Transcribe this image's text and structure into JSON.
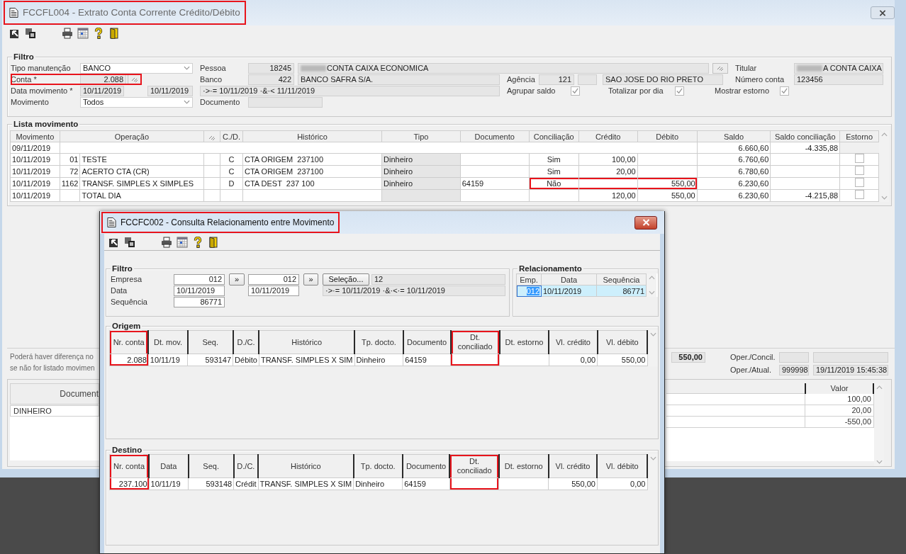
{
  "main_window": {
    "title": "FCCFL004 - Extrato Conta Corrente Crédito/Débito",
    "title_highlighted": true
  },
  "filtro": {
    "legend": "Filtro",
    "tipo_manutencao": {
      "label": "Tipo manutenção",
      "value": "BANCO"
    },
    "pessoa": {
      "label": "Pessoa",
      "code": "18245",
      "name": "CONTA CAIXA ECONOMICA",
      "redacted": true
    },
    "titular": {
      "label": "Titular",
      "value": "A CONTA CAIXA",
      "redacted": true
    },
    "conta": {
      "label": "Conta *",
      "value": "2.088",
      "highlighted": true
    },
    "banco": {
      "label": "Banco",
      "code": "422",
      "name": "BANCO SAFRA S/A."
    },
    "agencia": {
      "label": "Agência",
      "code": "121",
      "name": "SAO JOSE DO RIO PRETO"
    },
    "numero_conta": {
      "label": "Número conta",
      "value": "123456"
    },
    "data_movimento": {
      "label": "Data movimento *",
      "from": "10/11/2019",
      "to": "10/11/2019"
    },
    "period": "·>·= 10/11/2019 ·&·< 11/11/2019",
    "options": [
      {
        "label": "Agrupar saldo",
        "checked": true
      },
      {
        "label": "Totalizar por dia",
        "checked": true
      },
      {
        "label": "Mostrar estorno",
        "checked": true
      }
    ],
    "movimento": {
      "label": "Movimento",
      "value": "Todos"
    },
    "documento": {
      "label": "Documento"
    }
  },
  "lista": {
    "legend": "Lista movimento",
    "columns": [
      {
        "kind": "text",
        "label": "Movimento"
      },
      {
        "kind": "text",
        "label": "Operação"
      },
      {
        "kind": "icon"
      },
      {
        "kind": "text",
        "label": "C./D."
      },
      {
        "kind": "text",
        "label": "Histórico"
      },
      {
        "kind": "text",
        "label": "Tipo"
      },
      {
        "kind": "text",
        "label": "Documento"
      },
      {
        "kind": "text",
        "label": "Conciliação"
      },
      {
        "kind": "text",
        "label": "Crédito"
      },
      {
        "kind": "text",
        "label": "Débito"
      },
      {
        "kind": "text",
        "label": "Saldo"
      },
      {
        "kind": "text",
        "label": "Saldo conciliação"
      },
      {
        "kind": "text",
        "label": "Estorno"
      }
    ],
    "rows": [
      {
        "kind": "balance",
        "movimento": "09/11/2019",
        "saldo": "6.660,60",
        "saldo_conciliacao": "-4.335,88"
      },
      {
        "kind": "entry",
        "movimento": "10/11/2019",
        "codigo": "01",
        "operacao": "TESTE",
        "cd": "C",
        "historico": "CTA ORIGEM  237100",
        "tipo": "Dinheiro",
        "conciliacao": "Sim",
        "credito": "100,00",
        "saldo": "6.760,60",
        "estorno": false,
        "highlighted": false
      },
      {
        "kind": "entry",
        "movimento": "10/11/2019",
        "codigo": "72",
        "operacao": "ACERTO CTA (CR)",
        "cd": "C",
        "historico": "CTA ORIGEM  237100",
        "tipo": "Dinheiro",
        "conciliacao": "Sim",
        "credito": "20,00",
        "saldo": "6.780,60",
        "estorno": false,
        "highlighted": false
      },
      {
        "kind": "entry",
        "movimento": "10/11/2019",
        "codigo": "1162",
        "operacao": "TRANSF. SIMPLES X SIMPLES",
        "cd": "D",
        "historico": "CTA DEST  237 100",
        "tipo": "Dinheiro",
        "documento": "64159",
        "conciliacao": "Não",
        "debito": "550,00",
        "saldo": "6.230,60",
        "estorno": false,
        "highlighted": true
      },
      {
        "kind": "total",
        "movimento": "10/11/2019",
        "operacao": "TOTAL DIA",
        "credito": "120,00",
        "debito": "550,00",
        "saldo": "6.230,60",
        "saldo_conciliacao": "-4.215,88",
        "estorno": false
      }
    ]
  },
  "footer": {
    "note_lines": [
      "Poderá haver diferença no",
      "se não for listado movimen"
    ],
    "total": "550,00",
    "oper_concil": {
      "label": "Oper./Concil."
    },
    "oper_atual": {
      "label": "Oper./Atual.",
      "code": "999998",
      "datetime": "19/11/2019 15:45:38"
    }
  },
  "detalhe": {
    "column_1": "Document",
    "valor_header": "Valor",
    "left_rows": [
      "DINHEIRO"
    ],
    "valores": [
      "100,00",
      "20,00",
      "-550,00"
    ]
  },
  "dialog": {
    "title": "FCCFC002 - Consulta Relacionamento entre Movimento",
    "title_highlighted": true,
    "filtro": {
      "legend": "Filtro",
      "empresa": {
        "label": "Empresa",
        "from": "012",
        "to": "012"
      },
      "data": {
        "label": "Data",
        "from": "10/11/2019",
        "to": "10/11/2019"
      },
      "sequencia": {
        "label": "Sequência",
        "value": "86771"
      },
      "copy_buttons": [
        "»",
        "»"
      ],
      "selecao_button": "Seleção...",
      "selecao_value": "12",
      "expression": "·>·= 10/11/2019 ·&·<·= 10/11/2019"
    },
    "relacionamento": {
      "legend": "Relacionamento",
      "columns": [
        "Emp.",
        "Data",
        "Sequência"
      ],
      "rows": [
        {
          "emp": "012",
          "data": "10/11/2019",
          "sequencia": "86771",
          "selected": true
        }
      ]
    },
    "origem": {
      "legend": "Origem",
      "columns": [
        {
          "label": "Nr. conta",
          "highlighted": true
        },
        {
          "label": "Dt. mov.",
          "highlighted": false
        },
        {
          "label": "Seq.",
          "highlighted": false
        },
        {
          "label": "D./C.",
          "highlighted": false
        },
        {
          "label": "Histórico",
          "highlighted": false
        },
        {
          "label": "Tp. docto.",
          "highlighted": false
        },
        {
          "label": "Documento",
          "highlighted": false
        },
        {
          "label": "Dt. conciliado",
          "highlighted": true
        },
        {
          "label": "Dt. estorno",
          "highlighted": false
        },
        {
          "label": "Vl. crédito",
          "highlighted": false
        },
        {
          "label": "Vl. débito",
          "highlighted": false
        }
      ],
      "rows": [
        [
          "2.088",
          "10/11/19",
          "593147",
          "Débito",
          "TRANSF. SIMPLES X SIM",
          "Dinheiro",
          "64159",
          null,
          null,
          "0,00",
          "550,00"
        ]
      ]
    },
    "destino": {
      "legend": "Destino",
      "columns": [
        {
          "label": "Nr. conta",
          "highlighted": true
        },
        {
          "label": "Data",
          "highlighted": false
        },
        {
          "label": "Seq.",
          "highlighted": false
        },
        {
          "label": "D./C.",
          "highlighted": false
        },
        {
          "label": "Histórico",
          "highlighted": false
        },
        {
          "label": "Tp. docto.",
          "highlighted": false
        },
        {
          "label": "Documento",
          "highlighted": false
        },
        {
          "label": "Dt. conciliado",
          "highlighted": true
        },
        {
          "label": "Dt. estorno",
          "highlighted": false
        },
        {
          "label": "Vl. crédito",
          "highlighted": false
        },
        {
          "label": "Vl. débito",
          "highlighted": false
        }
      ],
      "rows": [
        [
          "237.100",
          "10/11/19",
          "593148",
          "Crédit",
          "TRANSF. SIMPLES X SIM",
          "Dinheiro",
          "64159",
          null,
          null,
          "550,00",
          "0,00"
        ]
      ]
    }
  }
}
